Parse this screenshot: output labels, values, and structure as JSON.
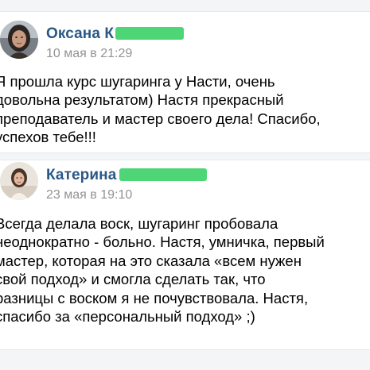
{
  "posts": [
    {
      "author": "Оксана К",
      "date": "10 мая в 21:29",
      "lines": [
        "Я прошла курс шугаринга у Насти, очень",
        "довольна результатом) Настя прекрасный",
        "преподаватель и мастер своего дела! Спасибо,",
        "успехов тебе!!!"
      ]
    },
    {
      "author": "Катерина",
      "date": "23 мая в 19:10",
      "lines": [
        "Всегда делала воск, шугаринг пробовала",
        "неоднократно - больно. Настя, умничка, первый",
        "мастер, которая на это сказала «всем нужен",
        "свой подход» и смогла сделать так, что",
        "разницы с воском я не почувствовала. Настя,",
        "спасибо за «персональный подход» ;)"
      ]
    }
  ],
  "colors": {
    "author": "#2a5885",
    "date": "#939393",
    "censor": "#3fd36a"
  }
}
